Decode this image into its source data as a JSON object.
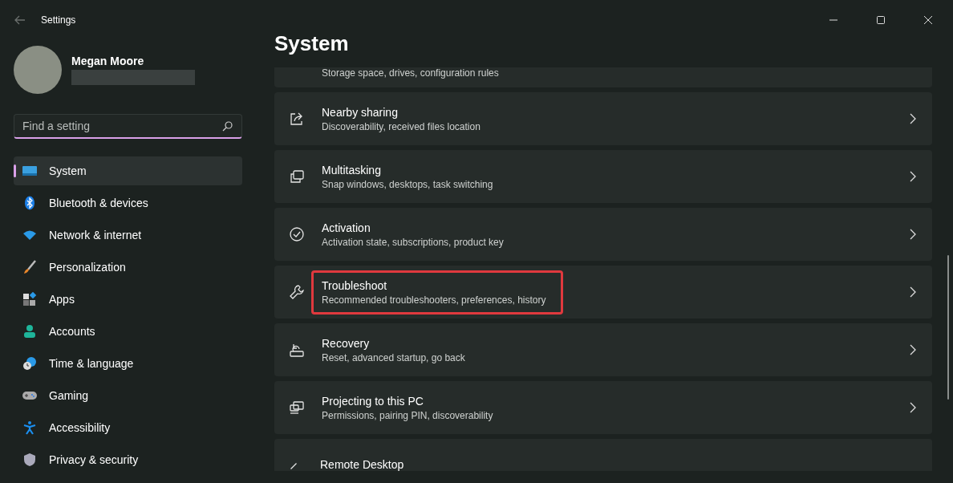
{
  "window": {
    "title": "Settings"
  },
  "profile": {
    "name": "Megan Moore"
  },
  "search": {
    "placeholder": "Find a setting",
    "focused": true
  },
  "sidebar": {
    "items": [
      {
        "label": "System",
        "selected": true
      },
      {
        "label": "Bluetooth & devices",
        "selected": false
      },
      {
        "label": "Network & internet",
        "selected": false
      },
      {
        "label": "Personalization",
        "selected": false
      },
      {
        "label": "Apps",
        "selected": false
      },
      {
        "label": "Accounts",
        "selected": false
      },
      {
        "label": "Time & language",
        "selected": false
      },
      {
        "label": "Gaming",
        "selected": false
      },
      {
        "label": "Accessibility",
        "selected": false
      },
      {
        "label": "Privacy & security",
        "selected": false
      }
    ]
  },
  "page": {
    "title": "System",
    "items": [
      {
        "kind": "partial-top",
        "subtitle": "Storage space, drives, configuration rules"
      },
      {
        "kind": "card",
        "title": "Nearby sharing",
        "subtitle": "Discoverability, received files location",
        "highlighted": false
      },
      {
        "kind": "card",
        "title": "Multitasking",
        "subtitle": "Snap windows, desktops, task switching",
        "highlighted": false
      },
      {
        "kind": "card",
        "title": "Activation",
        "subtitle": "Activation state, subscriptions, product key",
        "highlighted": false
      },
      {
        "kind": "card",
        "title": "Troubleshoot",
        "subtitle": "Recommended troubleshooters, preferences, history",
        "highlighted": true
      },
      {
        "kind": "card",
        "title": "Recovery",
        "subtitle": "Reset, advanced startup, go back",
        "highlighted": false
      },
      {
        "kind": "card",
        "title": "Projecting to this PC",
        "subtitle": "Permissions, pairing PIN, discoverability",
        "highlighted": false
      },
      {
        "kind": "partial-bottom",
        "title": "Remote Desktop"
      }
    ]
  }
}
